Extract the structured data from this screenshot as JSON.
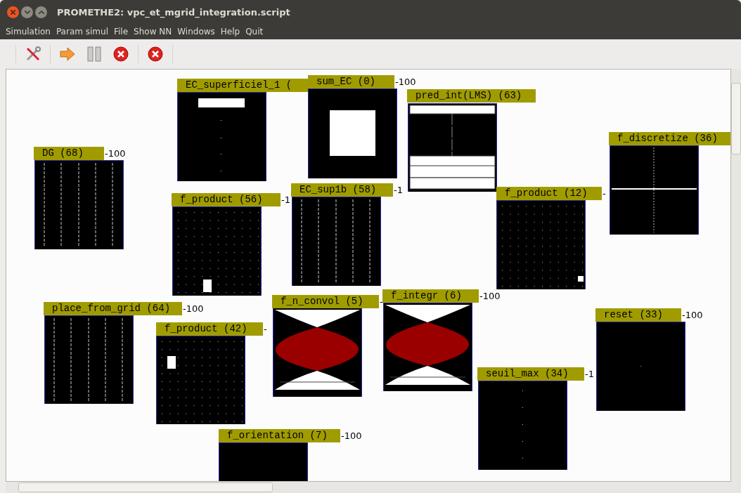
{
  "window": {
    "title": "PROMETHE2: vpc_et_mgrid_integration.script"
  },
  "menu": [
    "Simulation",
    "Param simul",
    "File",
    "Show NN",
    "Windows",
    "Help",
    "Quit"
  ],
  "groups": [
    {
      "label": "EC_superficiel_1 (",
      "kind": "bar-top"
    },
    {
      "label": "sum_EC (0)",
      "reading": "-100",
      "kind": "square"
    },
    {
      "label": "pred_int(LMS) (63)",
      "kind": "pred"
    },
    {
      "label": "DG (68)",
      "reading": "-100",
      "kind": "lines"
    },
    {
      "label": "f_product (56)",
      "reading": "-1",
      "kind": "grid"
    },
    {
      "label": "EC_sup1b (58)",
      "reading": "-1",
      "kind": "lines"
    },
    {
      "label": "f_product (12)",
      "reading": "-",
      "kind": "grid"
    },
    {
      "label": "f_discretize (36)",
      "kind": "cross"
    },
    {
      "label": "place_from_grid (64)",
      "reading": "-100",
      "kind": "lines"
    },
    {
      "label": "f_product (42)",
      "reading": "-",
      "kind": "grid"
    },
    {
      "label": "f_n_convol (5)",
      "reading": "-",
      "kind": "hourglass"
    },
    {
      "label": "f_integr (6)",
      "reading": "-100",
      "kind": "hourglass"
    },
    {
      "label": "seuil_max (34)",
      "reading": "-1",
      "kind": "dots"
    },
    {
      "label": "reset (33)",
      "reading": "-100",
      "kind": "blank"
    },
    {
      "label": "f_orientation (7)",
      "reading": "-100",
      "kind": "blank"
    }
  ]
}
